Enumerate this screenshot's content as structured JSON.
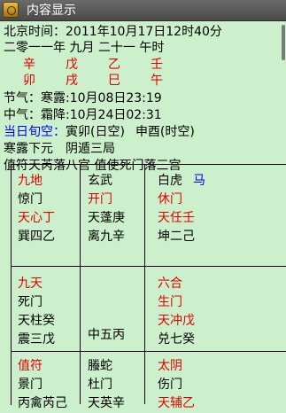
{
  "window": {
    "title": "内容显示"
  },
  "info": {
    "beijing_time": "北京时间：2011年10月17日12时40分",
    "lunar_date": "二零一一年 九月 二十一 午时",
    "ganzhi_top": [
      "辛",
      "戊",
      "乙",
      "壬"
    ],
    "ganzhi_bottom": [
      "卯",
      "戌",
      "巳",
      "午"
    ],
    "solar_term": "节气：寒露:10月08日23:19",
    "mid_term": "中气：霜降:10月24日02:31",
    "xunkong_label": "当日旬空：",
    "xunkong_day": "寅卯(日空)",
    "xunkong_hour": "申酉(时空)",
    "ju": "寒露下元　阴遁三局",
    "zhifu": "值符天芮落八宫 值使死门落三宫"
  },
  "palaces": [
    {
      "lines": [
        "九地",
        "惊门",
        "天心丁",
        "巽四乙"
      ],
      "colors": [
        "red",
        "black",
        "red",
        "black"
      ]
    },
    {
      "lines": [
        "玄武",
        "开门",
        "天蓬庚",
        "离九辛"
      ],
      "colors": [
        "black",
        "red",
        "black",
        "black"
      ]
    },
    {
      "lines": [
        "白虎",
        "休门",
        "天任壬",
        "坤二己"
      ],
      "colors": [
        "black",
        "red",
        "red",
        "black"
      ],
      "extra": "马"
    },
    {
      "lines": [
        "九天",
        "死门",
        "天柱癸",
        "震三戊"
      ],
      "colors": [
        "red",
        "black",
        "black",
        "black"
      ]
    },
    {
      "lines": [
        "中五丙"
      ],
      "colors": [
        "black"
      ]
    },
    {
      "lines": [
        "六合",
        "生门",
        "天冲戊",
        "兑七癸"
      ],
      "colors": [
        "red",
        "red",
        "red",
        "black"
      ]
    },
    {
      "lines": [
        "值符",
        "景门",
        "丙禽芮己"
      ],
      "colors": [
        "red",
        "black",
        "black"
      ]
    },
    {
      "lines": [
        "螣蛇",
        "杜门",
        "天英辛"
      ],
      "colors": [
        "black",
        "black",
        "black"
      ]
    },
    {
      "lines": [
        "太阴",
        "伤门",
        "天辅乙"
      ],
      "colors": [
        "red",
        "black",
        "red"
      ]
    }
  ]
}
